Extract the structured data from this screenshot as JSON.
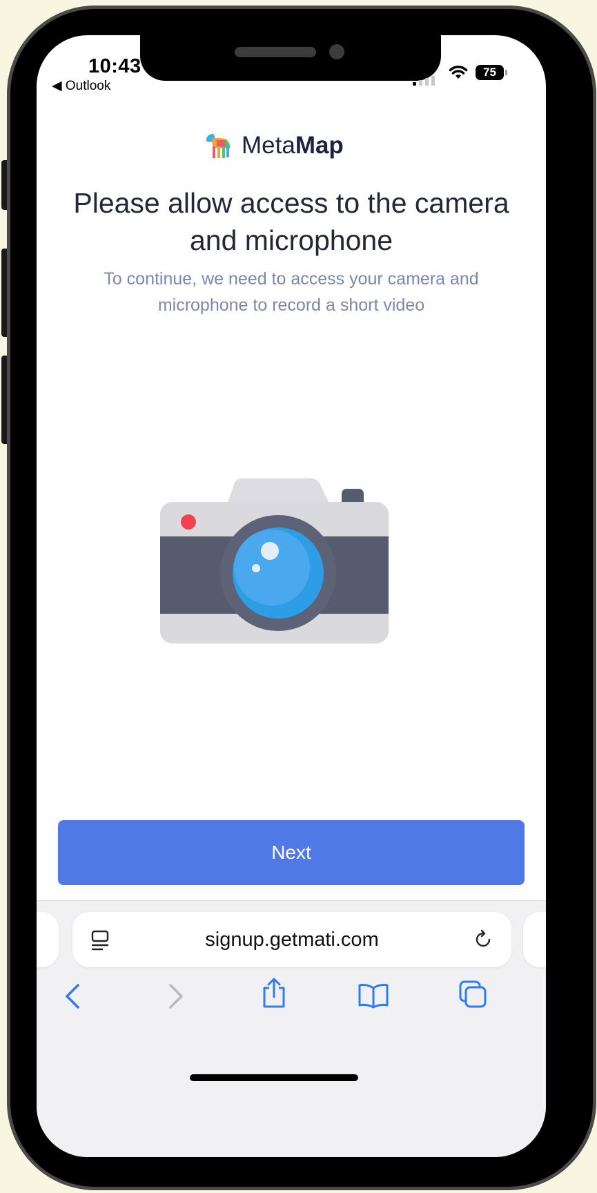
{
  "status_bar": {
    "time": "10:43",
    "back_app": "◀ Outlook",
    "battery": "75"
  },
  "brand": {
    "name_light": "Meta",
    "name_bold": "Map"
  },
  "page": {
    "title": "Please allow access to the camera and microphone",
    "subtitle": "To continue, we need to access your camera and microphone to record a short video",
    "next_label": "Next"
  },
  "browser": {
    "url": "signup.getmati.com"
  },
  "colors": {
    "accent": "#5079e6",
    "background": "#f8f6e0",
    "title_text": "#232838",
    "subtitle_text": "#7b88a8",
    "toolbar_icon": "#2f7bf5"
  },
  "icons": {
    "camera": "camera-illustration",
    "reader": "reader-mode-icon",
    "reload": "reload-icon",
    "back": "back-chevron-icon",
    "forward": "forward-chevron-icon",
    "share": "share-icon",
    "bookmarks": "bookmarks-icon",
    "tabs": "tabs-icon"
  }
}
